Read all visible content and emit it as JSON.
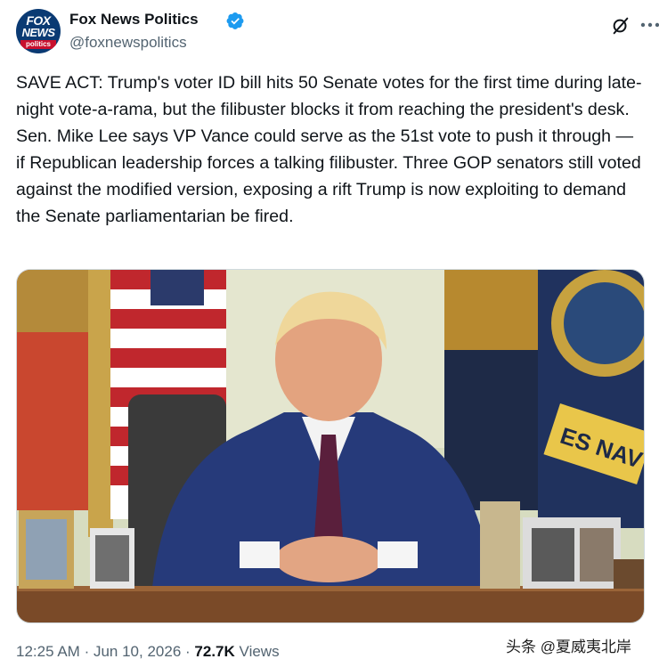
{
  "author": {
    "name": "Fox News Politics",
    "handle": "@foxnewspolitics",
    "verified": true,
    "avatar_logo": {
      "line1": "FOX",
      "line2": "NEWS",
      "line3": "politics"
    }
  },
  "icons": {
    "verified": "verified-badge-icon",
    "grok": "grok-icon",
    "more": "more-options-icon"
  },
  "colors": {
    "verified": "#1d9bf0",
    "secondary_text": "#536471",
    "primary_text": "#0f1419",
    "fox_navy": "#0a3a73",
    "fox_red": "#c8102e"
  },
  "tweet": {
    "text": "SAVE ACT: Trump's voter ID bill hits 50 Senate votes for the first time during late-night vote-a-rama, but the filibuster blocks it from reaching the president's desk. Sen. Mike Lee says VP Vance could serve as the 51st vote to push it through — if Republican leadership forces a talking filibuster. Three GOP senators still voted against the modified version, exposing a rift Trump is now exploiting to demand the Senate parliamentarian be fired."
  },
  "media": {
    "flag_text": "ES NAVY"
  },
  "meta": {
    "time": "12:25 AM",
    "date": "Jun 10, 2026",
    "views_count": "72.7K",
    "views_label": "Views",
    "separator": "·"
  },
  "watermark": "头条 @夏威夷北岸"
}
